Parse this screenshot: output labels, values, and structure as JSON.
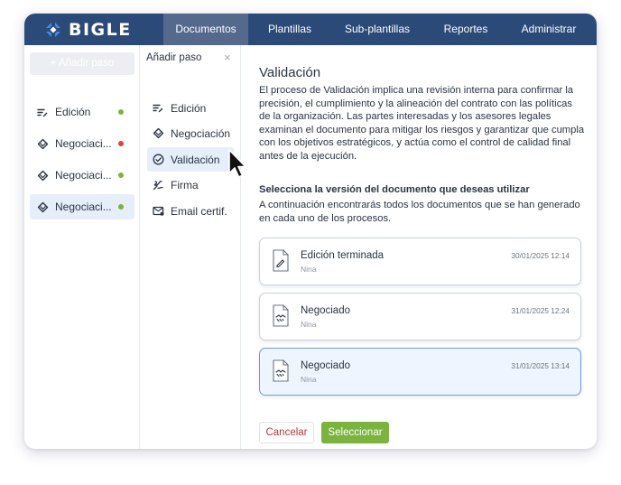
{
  "app": {
    "logo_text": "BIGLE"
  },
  "nav": {
    "items": [
      {
        "label": "Documentos"
      },
      {
        "label": "Plantillas"
      },
      {
        "label": "Sub-plantillas"
      },
      {
        "label": "Reportes"
      },
      {
        "label": "Administrar"
      }
    ],
    "active_index": 0
  },
  "steps_panel": {
    "add_button_label": "+ Añadir paso",
    "items": [
      {
        "label": "Edición",
        "icon": "edit-lines-icon",
        "status_color": "#7bb33f"
      },
      {
        "label": "Negociaci...",
        "icon": "handshake-icon",
        "status_color": "#d9453d"
      },
      {
        "label": "Negociaci...",
        "icon": "handshake-icon",
        "status_color": "#7bb33f"
      },
      {
        "label": "Negociaci...",
        "icon": "handshake-icon",
        "status_color": "#7bb33f"
      }
    ],
    "selected_index": 3
  },
  "add_step_menu": {
    "title": "Añadir paso",
    "close_glyph": "×",
    "items": [
      {
        "label": "Edición",
        "icon": "edit-lines-icon"
      },
      {
        "label": "Negociación",
        "icon": "handshake-icon"
      },
      {
        "label": "Validación",
        "icon": "check-circle-icon"
      },
      {
        "label": "Firma",
        "icon": "signature-icon"
      },
      {
        "label": "Email certif.",
        "icon": "email-certified-icon"
      }
    ],
    "hover_index": 2
  },
  "main": {
    "title": "Validación",
    "description": "El proceso de Validación implica una revisión interna para confirmar la precisión, el cumplimiento y la alineación del contrato con las políticas de la organización. Las partes interesadas y los asesores legales examinan el documento para mitigar los riesgos y garantizar que cumpla con los objetivos estratégicos, y actúa como el control de calidad final antes de la ejecución.",
    "version_title": "Selecciona la versión del documento que deseas utilizar",
    "version_description": "A continuación encontrarás todos los documentos que se han generado en cada uno de los procesos.",
    "versions": [
      {
        "name": "Edición terminada",
        "user": "Nina",
        "date": "30/01/2025 12:14",
        "icon": "document-edit-icon"
      },
      {
        "name": "Negociado",
        "user": "Nina",
        "date": "31/01/2025 12:24",
        "icon": "document-handshake-icon"
      },
      {
        "name": "Negociado",
        "user": "Nina",
        "date": "31/01/2025 13:14",
        "icon": "document-handshake-icon"
      }
    ],
    "selected_version_index": 2,
    "cancel_label": "Cancelar",
    "select_label": "Seleccionar"
  },
  "colors": {
    "navbar": "#2c4a78",
    "nav_active": "#54698c",
    "accent_green": "#7bb33f",
    "status_red": "#d9453d",
    "selection_blue": "#e6eefa",
    "card_selected_border": "#6d9be0",
    "cancel_text": "#b23a3a",
    "logo_mark": "#3d8bf2"
  }
}
